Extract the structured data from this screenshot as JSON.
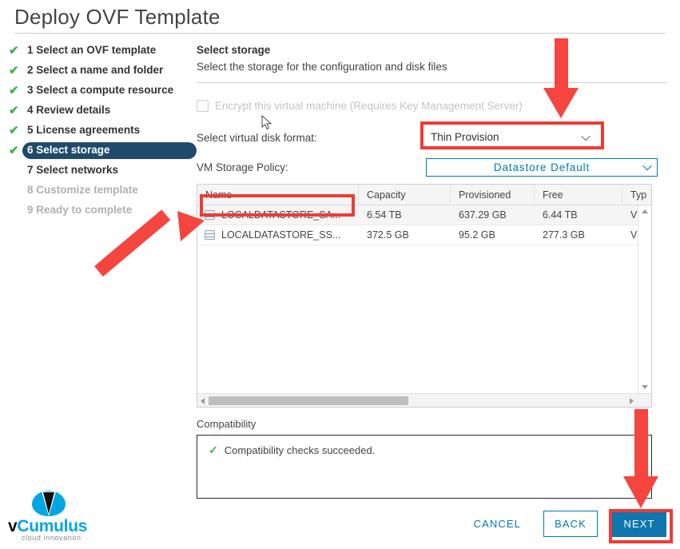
{
  "window": {
    "title": "Deploy OVF Template"
  },
  "sidebar": {
    "steps": [
      {
        "label": "1 Select an OVF template",
        "state": "done"
      },
      {
        "label": "2 Select a name and folder",
        "state": "done"
      },
      {
        "label": "3 Select a compute resource",
        "state": "done"
      },
      {
        "label": "4 Review details",
        "state": "done"
      },
      {
        "label": "5 License agreements",
        "state": "done"
      },
      {
        "label": "6 Select storage",
        "state": "current"
      },
      {
        "label": "7 Select networks",
        "state": "pending"
      },
      {
        "label": "8 Customize template",
        "state": "disabled"
      },
      {
        "label": "9 Ready to complete",
        "state": "disabled"
      }
    ],
    "check_glyph": "✔"
  },
  "panel": {
    "title": "Select storage",
    "subtitle": "Select the storage for the configuration and disk files",
    "encrypt_checkbox_label": "Encrypt this virtual machine (Requires Key Management Server)",
    "disk_format_label": "Select virtual disk format:",
    "disk_format_value": "Thin Provision",
    "storage_policy_label": "VM Storage Policy:",
    "storage_policy_value": "Datastore Default"
  },
  "table": {
    "columns": [
      "Name",
      "Capacity",
      "Provisioned",
      "Free",
      "Typ"
    ],
    "rows": [
      {
        "name": "LOCALDATASTORE_SA...",
        "capacity": "6.54 TB",
        "provisioned": "637.29 GB",
        "free": "6.44 TB",
        "type": "VM",
        "selected": true
      },
      {
        "name": "LOCALDATASTORE_SS...",
        "capacity": "372.5 GB",
        "provisioned": "95.2 GB",
        "free": "277.3 GB",
        "type": "VM",
        "selected": false
      }
    ]
  },
  "compatibility": {
    "label": "Compatibility",
    "message": "Compatibility checks succeeded.",
    "ok_glyph": "✓"
  },
  "footer": {
    "cancel_label": "CANCEL",
    "back_label": "BACK",
    "next_label": "NEXT"
  },
  "logo": {
    "prefix": "v",
    "name": "Cumulus",
    "tagline": "cloud innovation"
  },
  "colors": {
    "accent_blue": "#0079b8",
    "primary_button": "#0f76b0",
    "current_step": "#1f4a6b",
    "success_green": "#3ab54a",
    "annotation_red": "#ef3b36",
    "logo_cyan": "#00a6e2"
  }
}
